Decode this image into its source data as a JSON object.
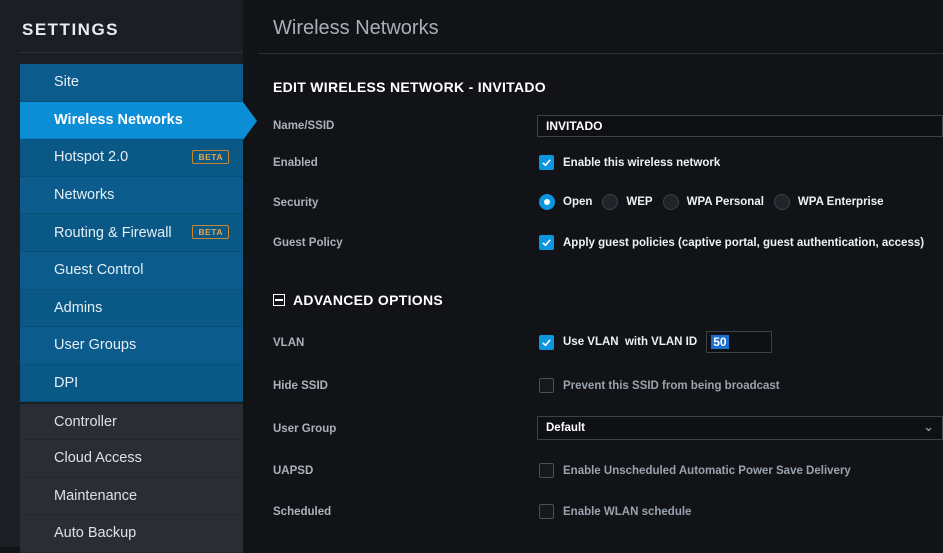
{
  "sidebar": {
    "title": "SETTINGS",
    "items": [
      {
        "label": "Site",
        "badge": ""
      },
      {
        "label": "Wireless Networks",
        "badge": ""
      },
      {
        "label": "Hotspot 2.0",
        "badge": "BETA"
      },
      {
        "label": "Networks",
        "badge": ""
      },
      {
        "label": "Routing & Firewall",
        "badge": "BETA"
      },
      {
        "label": "Guest Control",
        "badge": ""
      },
      {
        "label": "Admins",
        "badge": ""
      },
      {
        "label": "User Groups",
        "badge": ""
      },
      {
        "label": "DPI",
        "badge": ""
      },
      {
        "label": "Controller",
        "badge": ""
      },
      {
        "label": "Cloud Access",
        "badge": ""
      },
      {
        "label": "Maintenance",
        "badge": ""
      },
      {
        "label": "Auto Backup",
        "badge": ""
      }
    ],
    "active_index": 1
  },
  "main": {
    "page_title": "Wireless Networks",
    "section_title": "EDIT WIRELESS NETWORK - INVITADO",
    "advanced_title": "ADVANCED OPTIONS",
    "fields": {
      "name": {
        "label": "Name/SSID",
        "value": "INVITADO"
      },
      "enabled": {
        "label": "Enabled",
        "checkbox_label": "Enable this wireless network",
        "checked": true
      },
      "security": {
        "label": "Security",
        "options": [
          "Open",
          "WEP",
          "WPA Personal",
          "WPA Enterprise"
        ],
        "selected": "Open"
      },
      "guest_policy": {
        "label": "Guest Policy",
        "checkbox_label": "Apply guest policies (captive portal, guest authentication, access)",
        "checked": true
      },
      "vlan": {
        "label": "VLAN",
        "checkbox_label": "Use VLAN  with VLAN ID",
        "checked": true,
        "value": "50"
      },
      "hide_ssid": {
        "label": "Hide SSID",
        "checkbox_label": "Prevent this SSID from being broadcast",
        "checked": false
      },
      "user_group": {
        "label": "User Group",
        "value": "Default"
      },
      "uapsd": {
        "label": "UAPSD",
        "checkbox_label": "Enable Unscheduled Automatic Power Save Delivery",
        "checked": false
      },
      "scheduled": {
        "label": "Scheduled",
        "checkbox_label": "Enable WLAN schedule",
        "checked": false
      }
    }
  },
  "colors": {
    "accent": "#0b8ed6",
    "sidebar_blue": "#0b5c8c",
    "background": "#111317",
    "beta_badge": "#e5a74a"
  }
}
